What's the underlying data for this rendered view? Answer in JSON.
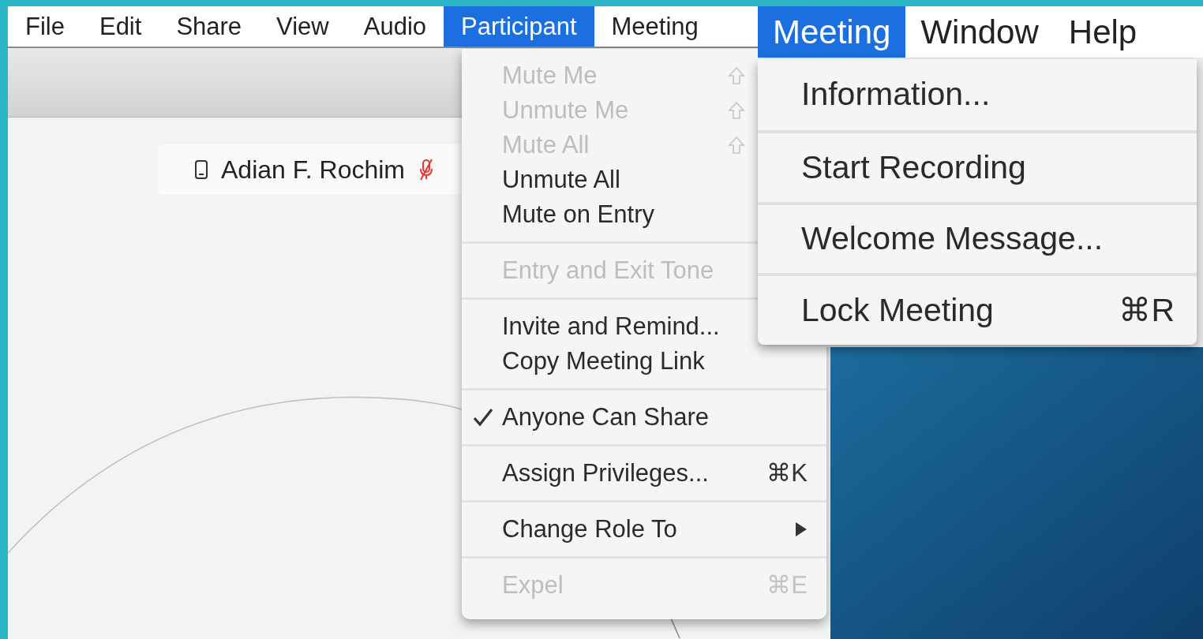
{
  "app_window": {
    "menubar": [
      {
        "label": "File",
        "selected": false
      },
      {
        "label": "Edit",
        "selected": false
      },
      {
        "label": "Share",
        "selected": false
      },
      {
        "label": "View",
        "selected": false
      },
      {
        "label": "Audio",
        "selected": false
      },
      {
        "label": "Participant",
        "selected": true
      },
      {
        "label": "Meeting",
        "selected": false
      }
    ],
    "participant": {
      "name": "Adian F. Rochim",
      "muted": true
    },
    "participant_menu": [
      [
        {
          "kind": "shift",
          "label": "Mute Me",
          "disabled": true,
          "checked": false
        },
        {
          "kind": "shift",
          "label": "Unmute Me",
          "disabled": true,
          "checked": false
        },
        {
          "kind": "shift",
          "label": "Mute All",
          "disabled": true,
          "checked": false
        },
        {
          "kind": "plain",
          "label": "Unmute All",
          "disabled": false,
          "checked": false
        },
        {
          "kind": "plain",
          "label": "Mute on Entry",
          "disabled": false,
          "checked": false
        }
      ],
      [
        {
          "kind": "plain",
          "label": "Entry and Exit Tone",
          "disabled": true,
          "checked": false
        }
      ],
      [
        {
          "kind": "plain",
          "label": "Invite and Remind...",
          "disabled": false,
          "checked": false
        },
        {
          "kind": "plain",
          "label": "Copy Meeting Link",
          "disabled": false,
          "checked": false
        }
      ],
      [
        {
          "kind": "plain",
          "label": "Anyone Can Share",
          "disabled": false,
          "checked": true
        }
      ],
      [
        {
          "kind": "shortcut",
          "label": "Assign Privileges...",
          "disabled": false,
          "checked": false,
          "shortcut": "⌘K"
        }
      ],
      [
        {
          "kind": "submenu",
          "label": "Change Role To",
          "disabled": false,
          "checked": false
        }
      ],
      [
        {
          "kind": "shortcut",
          "label": "Expel",
          "disabled": true,
          "checked": false,
          "shortcut": "⌘E"
        }
      ]
    ]
  },
  "zoomed_window": {
    "menubar": [
      {
        "label": "Meeting",
        "selected": true
      },
      {
        "label": "Window",
        "selected": false
      },
      {
        "label": "Help",
        "selected": false
      }
    ],
    "meeting_menu": [
      {
        "label": "Information...",
        "disabled": false
      },
      {
        "label": "Start Recording",
        "disabled": false
      },
      {
        "label": "Welcome Message...",
        "disabled": false
      },
      {
        "label": "Lock Meeting",
        "disabled": false,
        "shortcut": "⌘R"
      }
    ]
  }
}
